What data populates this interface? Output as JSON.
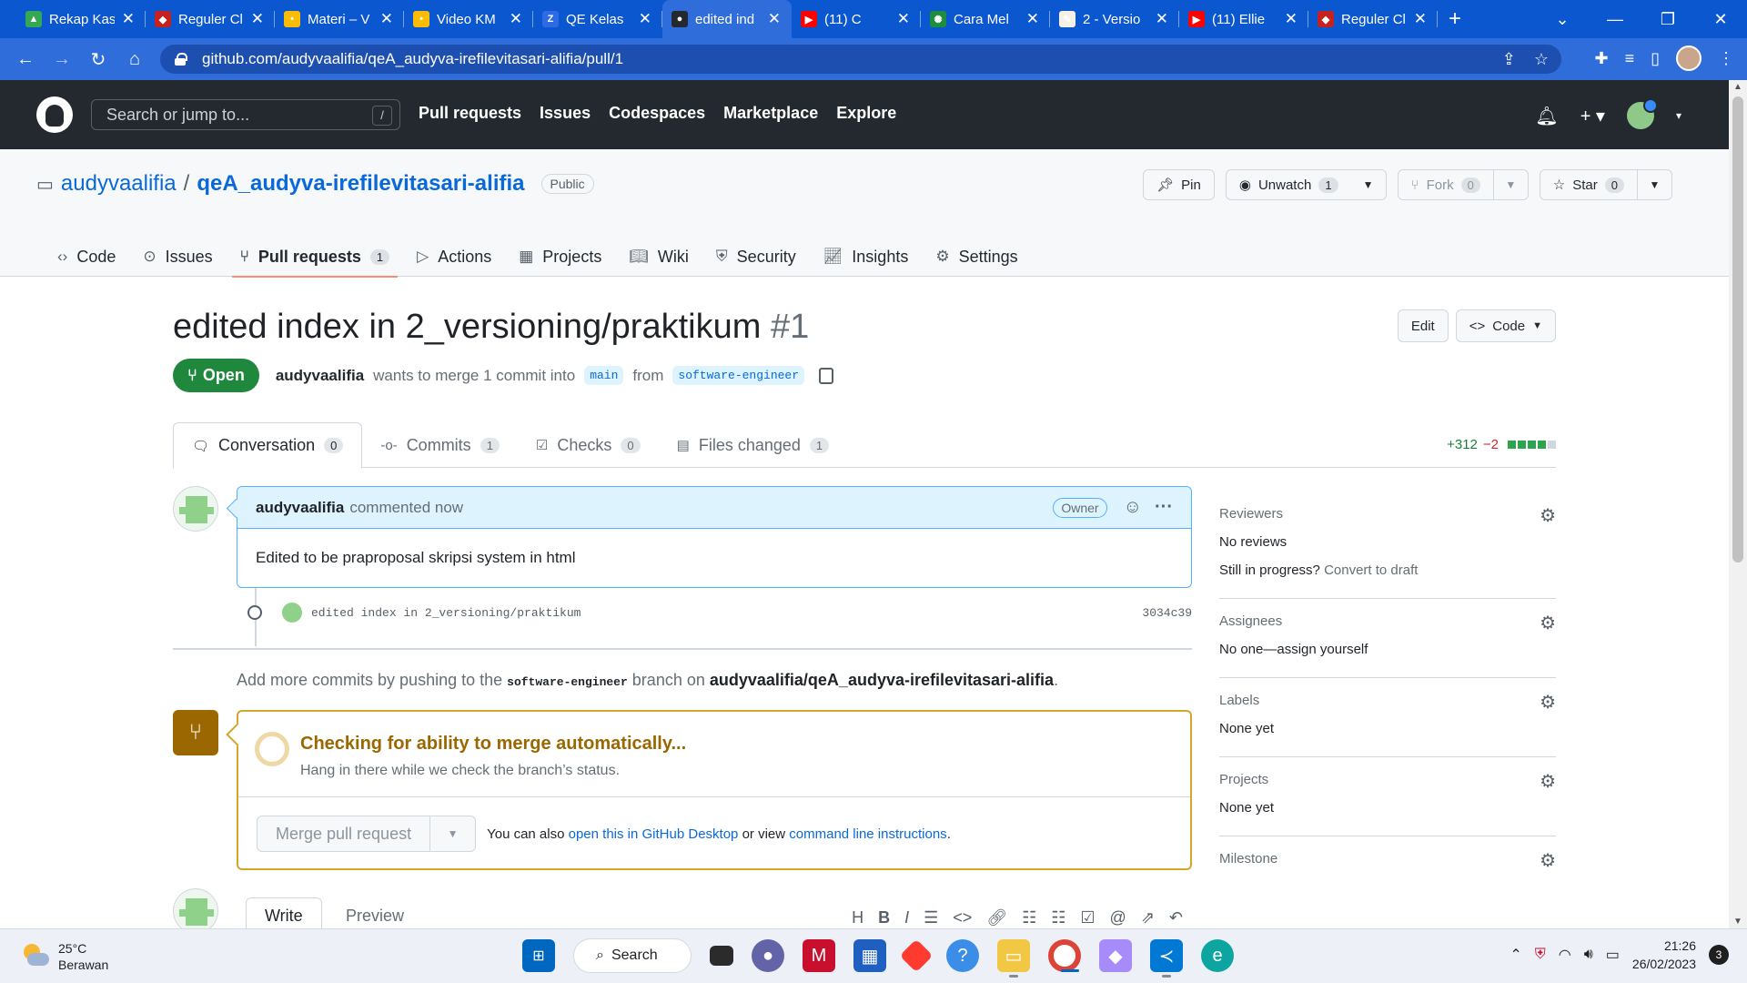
{
  "browser": {
    "tabs": [
      {
        "title": "Rekap Kasus",
        "color": "#34a853",
        "glyph": "▲"
      },
      {
        "title": "Reguler Cl",
        "color": "#c5221f",
        "glyph": "◆"
      },
      {
        "title": "Materi – V",
        "color": "#fbbc04",
        "glyph": "•"
      },
      {
        "title": "Video KM",
        "color": "#fbbc04",
        "glyph": "•"
      },
      {
        "title": "QE Kelas",
        "color": "#2d6be4",
        "glyph": "Z"
      },
      {
        "title": "edited ind",
        "color": "#24292f",
        "glyph": "●"
      },
      {
        "title": "(11) C",
        "color": "#ff0000",
        "glyph": "▶"
      },
      {
        "title": "Cara Mel",
        "color": "#1e8e3e",
        "glyph": "✺"
      },
      {
        "title": "2 - Versio",
        "color": "#f6f1e7",
        "glyph": "✎"
      },
      {
        "title": "(11) Ellie",
        "color": "#ff0000",
        "glyph": "▶"
      },
      {
        "title": "Reguler Cl",
        "color": "#c5221f",
        "glyph": "◆"
      }
    ],
    "active_tab_index": 5,
    "url": "github.com/audyvaalifia/qeA_audyva-irefilevitasari-alifia/pull/1"
  },
  "github": {
    "search_placeholder": "Search or jump to...",
    "search_shortcut": "/",
    "nav": [
      "Pull requests",
      "Issues",
      "Codespaces",
      "Marketplace",
      "Explore"
    ],
    "owner": "audyvaalifia",
    "repo": "qeA_audyva-irefilevitasari-alifia",
    "visibility": "Public",
    "pin_label": "Pin",
    "unwatch_label": "Unwatch",
    "unwatch_count": "1",
    "fork_label": "Fork",
    "fork_count": "0",
    "star_label": "Star",
    "star_count": "0",
    "repo_tabs": [
      {
        "label": "Code",
        "icon": "code-icon"
      },
      {
        "label": "Issues",
        "icon": "issue-icon"
      },
      {
        "label": "Pull requests",
        "icon": "pull-request-icon",
        "count": "1"
      },
      {
        "label": "Actions",
        "icon": "play-icon"
      },
      {
        "label": "Projects",
        "icon": "table-icon"
      },
      {
        "label": "Wiki",
        "icon": "book-icon"
      },
      {
        "label": "Security",
        "icon": "shield-icon"
      },
      {
        "label": "Insights",
        "icon": "graph-icon"
      },
      {
        "label": "Settings",
        "icon": "gear-icon"
      }
    ]
  },
  "pr": {
    "title": "edited index in 2_versioning/praktikum",
    "number": "#1",
    "edit_label": "Edit",
    "code_label": "Code",
    "state": "Open",
    "author": "audyvaalifia",
    "merge_text": "wants to merge 1 commit into",
    "base_branch": "main",
    "from_text": "from",
    "head_branch": "software-engineer",
    "tabs": [
      {
        "label": "Conversation",
        "count": "0"
      },
      {
        "label": "Commits",
        "count": "1"
      },
      {
        "label": "Checks",
        "count": "0"
      },
      {
        "label": "Files changed",
        "count": "1"
      }
    ],
    "additions": "+312",
    "deletions": "−2",
    "comment": {
      "author": "audyvaalifia",
      "action": "commented now",
      "role": "Owner",
      "body": "Edited to be praproposal skripsi system in html"
    },
    "commit": {
      "message": "edited index in 2_versioning/praktikum",
      "sha": "3034c39"
    },
    "add_more": {
      "prefix": "Add more commits by pushing to the",
      "branch": "software-engineer",
      "middle": "branch on",
      "repo": "audyvaalifia/qeA_audyva-irefilevitasari-alifia",
      "suffix": "."
    },
    "merge": {
      "title": "Checking for ability to merge automatically...",
      "subtitle": "Hang in there while we check the branch’s status.",
      "button": "Merge pull request",
      "also_text": "You can also",
      "desktop_link": "open this in GitHub Desktop",
      "or_text": "or view",
      "cli_link": "command line instructions",
      "end": "."
    },
    "write_tab": "Write",
    "preview_tab": "Preview"
  },
  "sidebar": {
    "reviewers": {
      "heading": "Reviewers",
      "value": "No reviews",
      "progress_text": "Still in progress?",
      "progress_link": "Convert to draft"
    },
    "assignees": {
      "heading": "Assignees",
      "value": "No one—assign yourself"
    },
    "labels": {
      "heading": "Labels",
      "value": "None yet"
    },
    "projects": {
      "heading": "Projects",
      "value": "None yet"
    },
    "milestone": {
      "heading": "Milestone"
    }
  },
  "taskbar": {
    "temperature": "25°C",
    "condition": "Berawan",
    "search_label": "Search",
    "time": "21:26",
    "date": "26/02/2023",
    "notification_count": "3"
  }
}
